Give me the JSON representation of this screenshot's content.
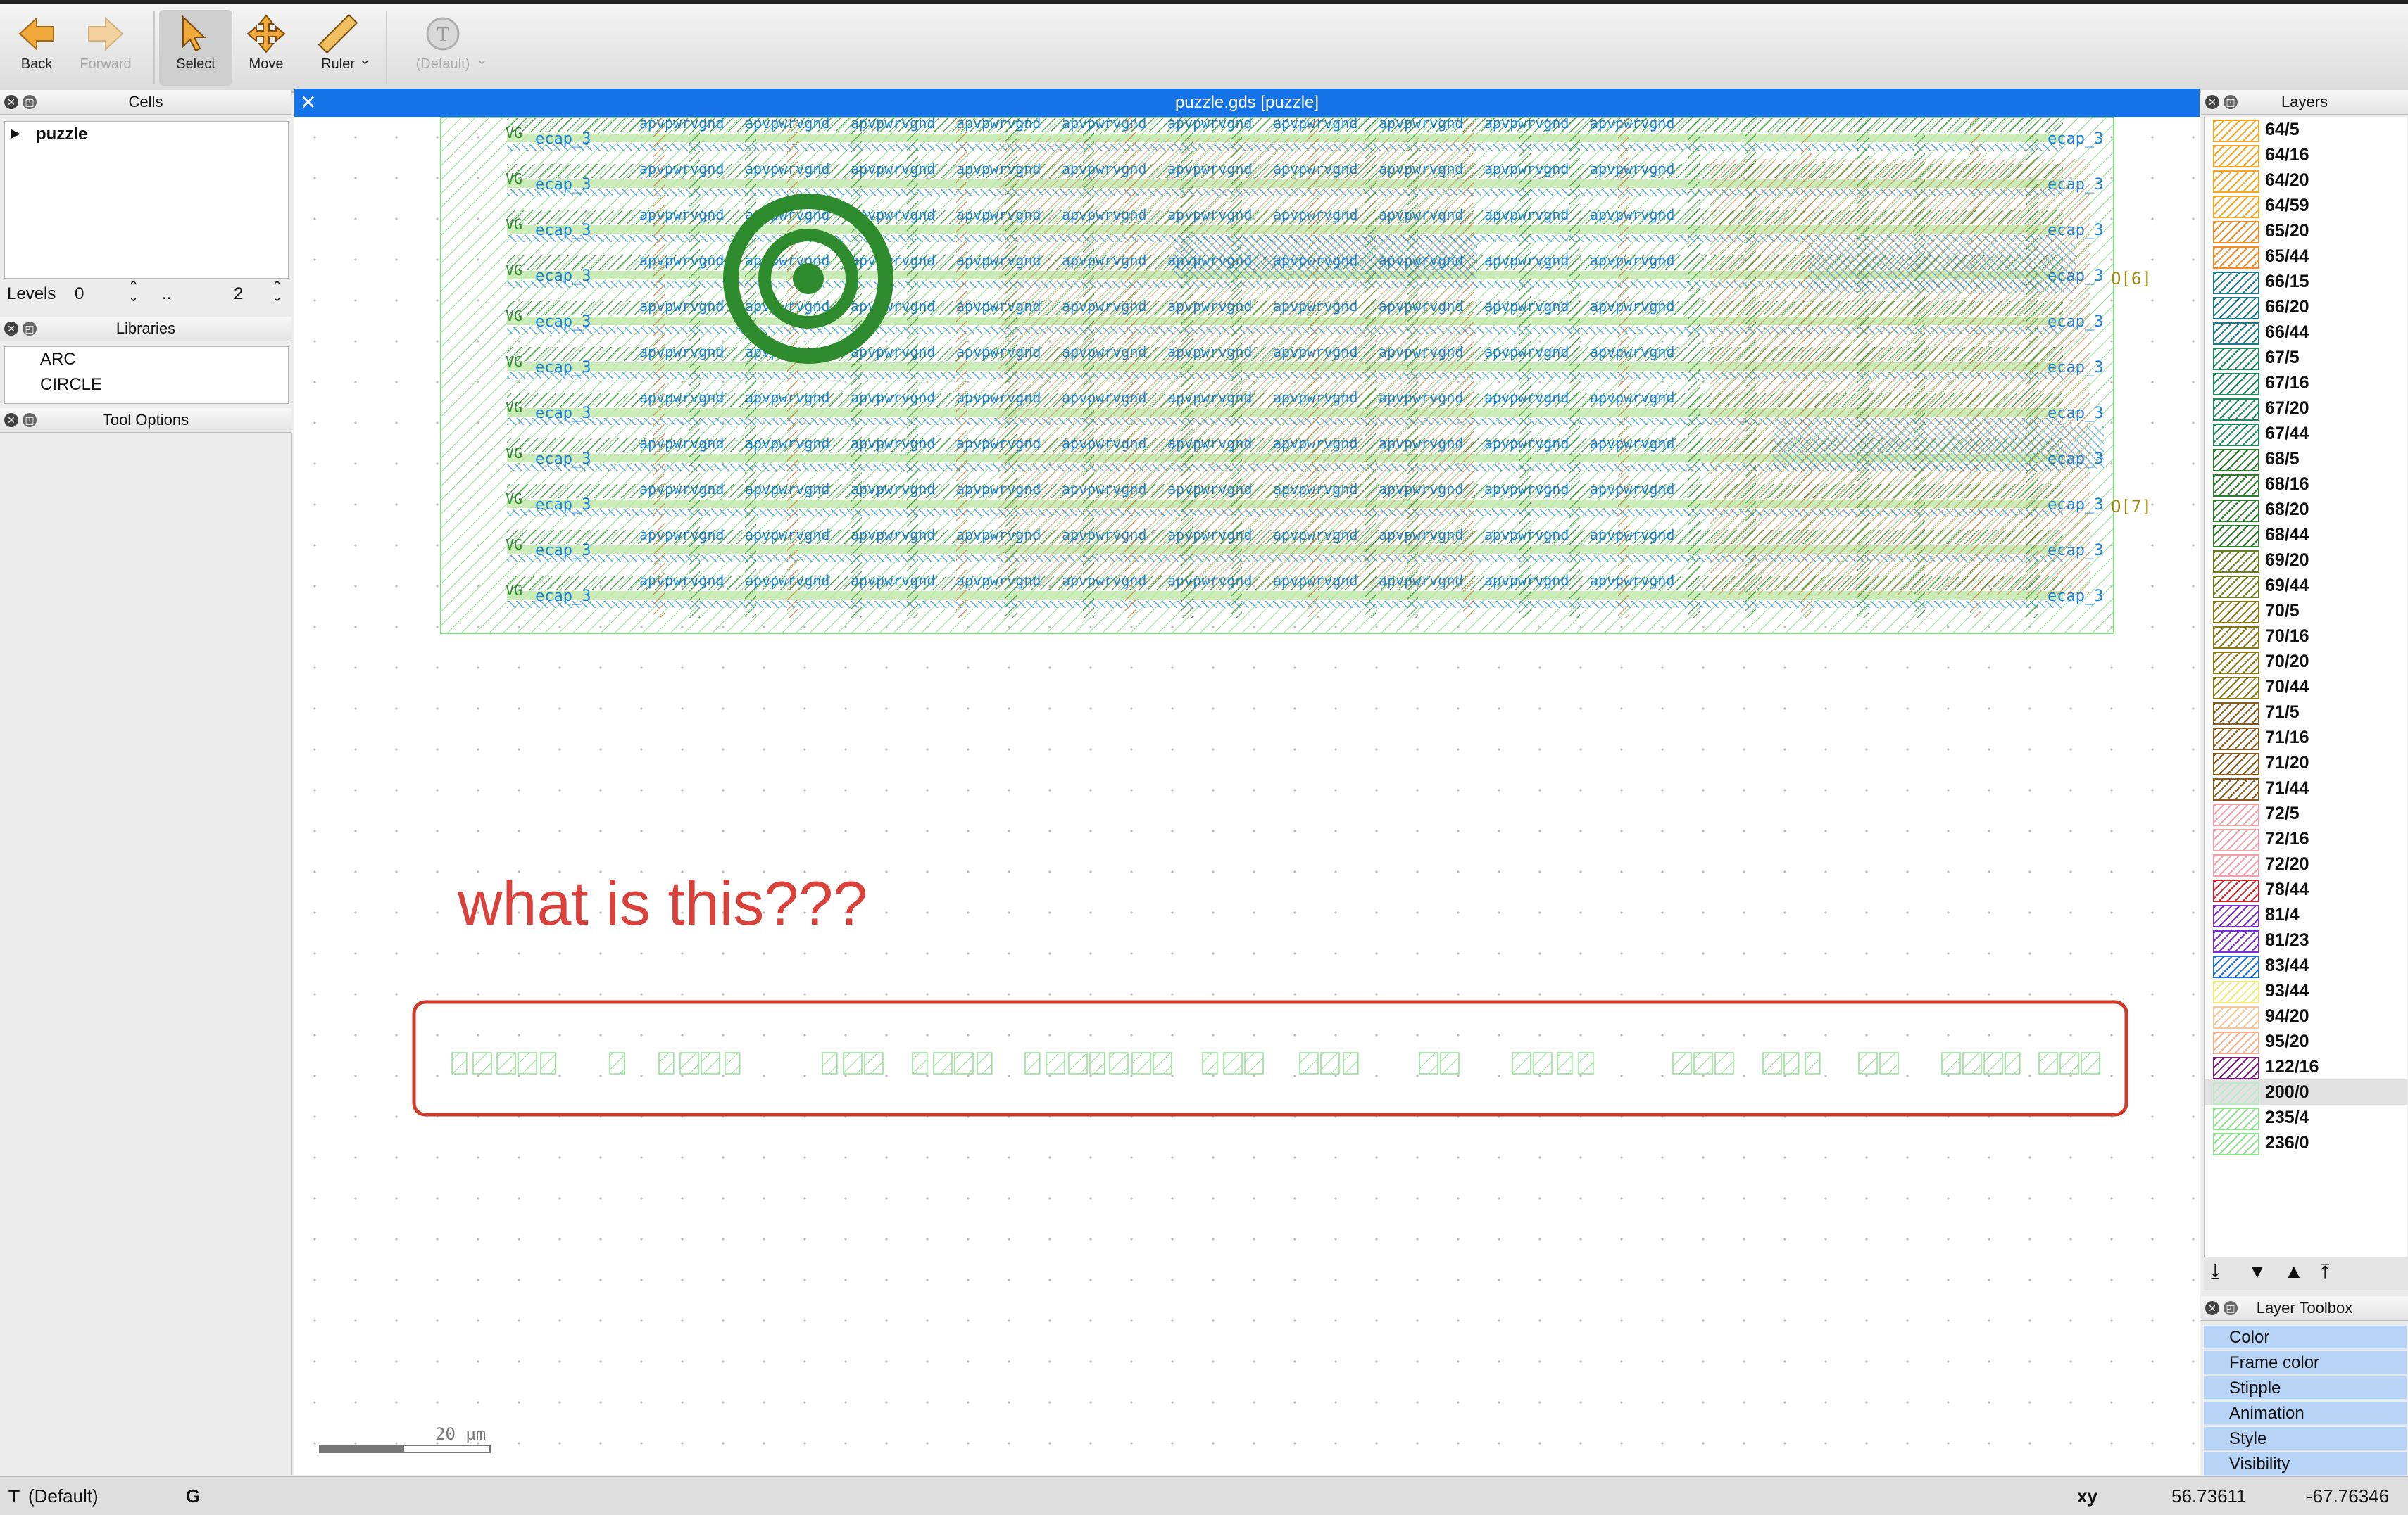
{
  "toolbar": {
    "back": "Back",
    "forward": "Forward",
    "select": "Select",
    "move": "Move",
    "ruler": "Ruler",
    "default_label": "(Default)"
  },
  "cells_panel": {
    "title": "Cells",
    "items": [
      "puzzle"
    ],
    "levels_label": "Levels",
    "level_from": "0",
    "level_sep": "..",
    "level_to": "2"
  },
  "libraries_panel": {
    "title": "Libraries",
    "items": [
      "ARC",
      "CIRCLE"
    ]
  },
  "tool_options_panel": {
    "title": "Tool Options"
  },
  "canvas": {
    "window_title": "puzzle.gds [puzzle]",
    "annotation_text": "what is this???",
    "scale_label": "20 µm",
    "pin_labels": [
      "O[6]",
      "O[7]"
    ],
    "cell_label": "ecap_3",
    "row_text": "apvpwrvgnd",
    "net_label": "VG"
  },
  "layers_panel": {
    "title": "Layers",
    "selected": "200/0",
    "layers": [
      {
        "name": "64/5",
        "color": "#f5a623"
      },
      {
        "name": "64/16",
        "color": "#f5a623"
      },
      {
        "name": "64/20",
        "color": "#f5a623"
      },
      {
        "name": "64/59",
        "color": "#f5a623"
      },
      {
        "name": "65/20",
        "color": "#f08a24"
      },
      {
        "name": "65/44",
        "color": "#f08a24"
      },
      {
        "name": "66/15",
        "color": "#1d7a8c"
      },
      {
        "name": "66/20",
        "color": "#1d7a8c"
      },
      {
        "name": "66/44",
        "color": "#1d7a8c"
      },
      {
        "name": "67/5",
        "color": "#1f8a5a"
      },
      {
        "name": "67/16",
        "color": "#1f8a5a"
      },
      {
        "name": "67/20",
        "color": "#1f8a5a"
      },
      {
        "name": "67/44",
        "color": "#1f8a5a"
      },
      {
        "name": "68/5",
        "color": "#2f7d2f"
      },
      {
        "name": "68/16",
        "color": "#2f7d2f"
      },
      {
        "name": "68/20",
        "color": "#2f7d2f"
      },
      {
        "name": "68/44",
        "color": "#2f7d2f"
      },
      {
        "name": "69/20",
        "color": "#6b7f1f"
      },
      {
        "name": "69/44",
        "color": "#6b7f1f"
      },
      {
        "name": "70/5",
        "color": "#8a7a15"
      },
      {
        "name": "70/16",
        "color": "#8a7a15"
      },
      {
        "name": "70/20",
        "color": "#8a7a15"
      },
      {
        "name": "70/44",
        "color": "#8a7a15"
      },
      {
        "name": "71/5",
        "color": "#8a5a1a"
      },
      {
        "name": "71/16",
        "color": "#8a5a1a"
      },
      {
        "name": "71/20",
        "color": "#8a5a1a"
      },
      {
        "name": "71/44",
        "color": "#8a5a1a"
      },
      {
        "name": "72/5",
        "color": "#f2a0a8"
      },
      {
        "name": "72/16",
        "color": "#f2a0a8"
      },
      {
        "name": "72/20",
        "color": "#f2a0a8"
      },
      {
        "name": "78/44",
        "color": "#d21f2a"
      },
      {
        "name": "81/4",
        "color": "#7b2fd0"
      },
      {
        "name": "81/23",
        "color": "#7b2fd0"
      },
      {
        "name": "83/44",
        "color": "#1f6fe0"
      },
      {
        "name": "93/44",
        "color": "#f2ea7a"
      },
      {
        "name": "94/20",
        "color": "#f7c69a"
      },
      {
        "name": "95/20",
        "color": "#f5b08a"
      },
      {
        "name": "122/16",
        "color": "#7a1f7a"
      },
      {
        "name": "200/0",
        "color": "#bde9c6"
      },
      {
        "name": "235/4",
        "color": "#8fe08f"
      },
      {
        "name": "236/0",
        "color": "#8fe08f"
      }
    ]
  },
  "layer_toolbox": {
    "title": "Layer Toolbox",
    "items": [
      "Color",
      "Frame color",
      "Stipple",
      "Animation",
      "Style",
      "Visibility"
    ]
  },
  "status_bar": {
    "mode_letter": "T",
    "mode_value": "(Default)",
    "grid_letter": "G",
    "coord_label": "xy",
    "x": "56.73611",
    "y": "-67.76346"
  },
  "colors": {
    "accent": "#1473e6",
    "annotation": "#d9413a",
    "layout_green": "#2e8b2e",
    "layout_blue": "#1b7fd8",
    "layout_brown": "#a0522d"
  }
}
